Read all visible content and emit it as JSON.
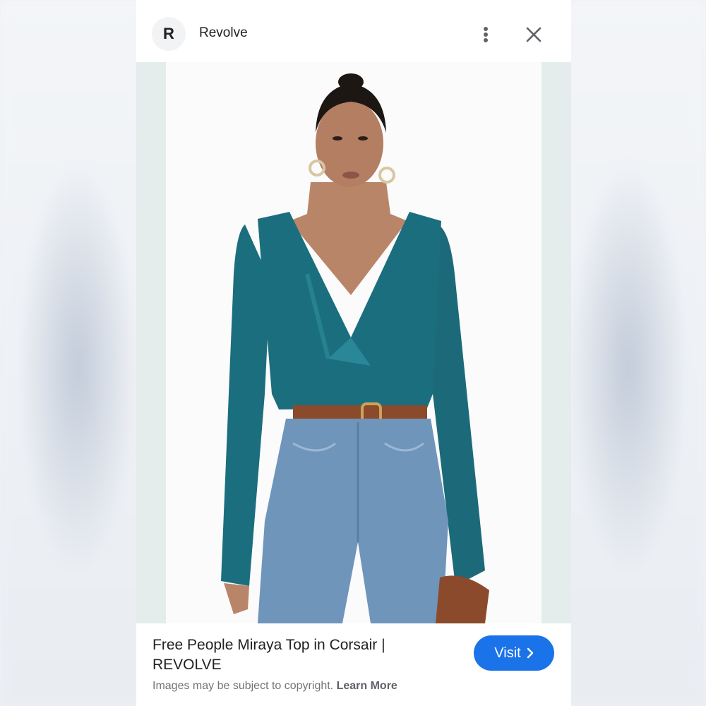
{
  "colors": {
    "accent": "#1a73e8",
    "top_color": "#1b6e7e",
    "jeans_color": "#6f95bb"
  },
  "header": {
    "avatar_letter": "R",
    "site_name": "Revolve",
    "more_icon": "more-vert-icon",
    "close_icon": "close-icon"
  },
  "product": {
    "title": "Free People Miraya Top in Corsair | REVOLVE",
    "visit_label": "Visit",
    "visit_icon": "chevron-right-icon",
    "disclaimer": "Images may be subject to copyright.",
    "learn_more": "Learn More"
  }
}
